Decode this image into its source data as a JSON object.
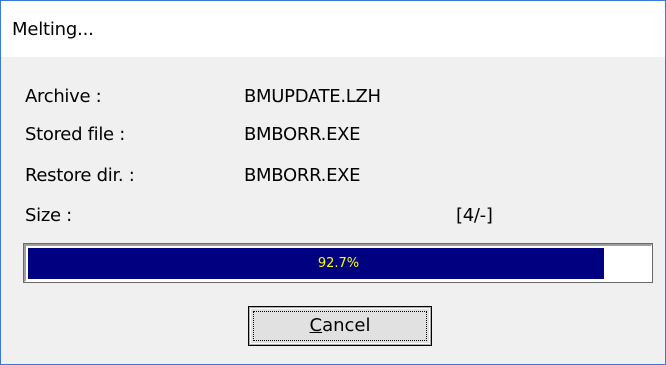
{
  "window": {
    "title": "Melting..."
  },
  "fields": {
    "archive": {
      "label": "Archive    :",
      "value": "BMUPDATE.LZH"
    },
    "stored_file": {
      "label": "Stored file :",
      "value": "BMBORR.EXE"
    },
    "restore_dir": {
      "label": "Restore dir. :",
      "value": "BMBORR.EXE"
    },
    "size": {
      "label": "Size      :",
      "value": "[4/-]"
    }
  },
  "progress": {
    "percent": 92.7,
    "text": "92.7%",
    "fill_color": "#000080",
    "text_color": "#ffff00"
  },
  "buttons": {
    "cancel": {
      "mnemonic": "C",
      "rest": "ancel"
    }
  }
}
